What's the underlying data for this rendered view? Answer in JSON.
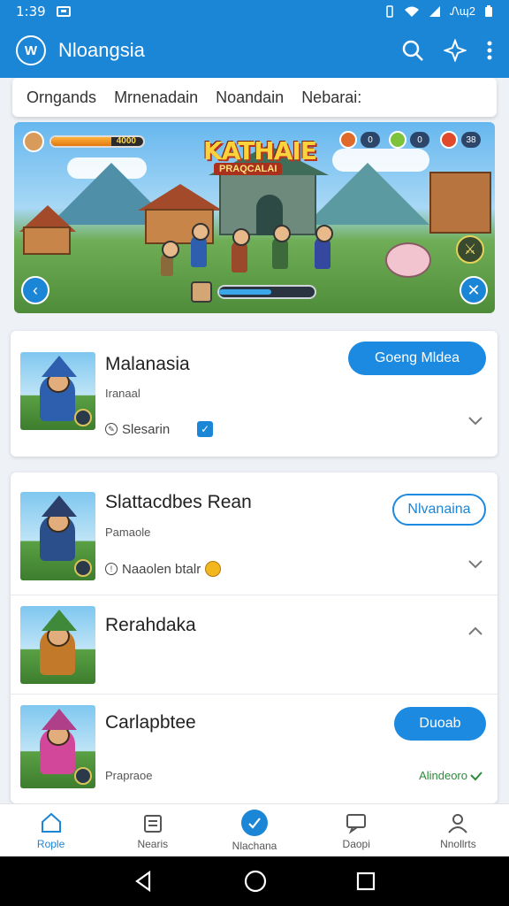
{
  "status_bar": {
    "time": "1:39",
    "right_text": "Ꮑɰ2"
  },
  "app_bar": {
    "logo_text": "W",
    "title": "Nloangsia"
  },
  "tabs": [
    "Orngands",
    "Mrnenadain",
    "Noandain",
    "Nebarai:"
  ],
  "banner": {
    "title": "KATHAIE",
    "subtitle": "PRAQCALAI",
    "hp_value": "4000",
    "hp_fill": 0.65,
    "xp_fill": 0.55,
    "resources": [
      {
        "value": "0",
        "color": "#e06a2a"
      },
      {
        "value": "0",
        "color": "#7cc23a"
      },
      {
        "value": "38",
        "color": "#e04a2a"
      }
    ]
  },
  "games": [
    {
      "name": "Malanasia",
      "sub": "Iranaal",
      "meta": "Slesarin",
      "button": "Goeng Mldea",
      "button_style": "primary",
      "hero_color": "#2d5fae",
      "hat_color": "#2d5fae"
    },
    {
      "name": "Slattacdbes Rean",
      "sub": "Pamaole",
      "meta": "Naaolen btalr",
      "button": "Nlvanaina",
      "button_style": "outline",
      "hero_color": "#2b4f8a",
      "hat_color": "#2b3f6a"
    },
    {
      "name": "Rerahdaka",
      "sub": "",
      "meta": "",
      "button": "",
      "button_style": "none",
      "hero_color": "#c27a2a",
      "hat_color": "#3f8a3a"
    },
    {
      "name": "Carlapbtee",
      "sub": "Prapraoe",
      "meta": "",
      "button": "Duoab",
      "button_style": "primary",
      "status": "Alindeoro",
      "hero_color": "#d2479a",
      "hat_color": "#b03f8a"
    }
  ],
  "bottom_nav": [
    {
      "label": "Rople",
      "icon": "home-icon"
    },
    {
      "label": "Nearis",
      "icon": "calendar-icon"
    },
    {
      "label": "Nlachana",
      "icon": "compass-icon"
    },
    {
      "label": "Daopi",
      "icon": "chat-icon"
    },
    {
      "label": "Nnollrts",
      "icon": "profile-icon"
    }
  ],
  "colors": {
    "primary": "#1b86d6",
    "accent_green": "#2e8a3a"
  }
}
